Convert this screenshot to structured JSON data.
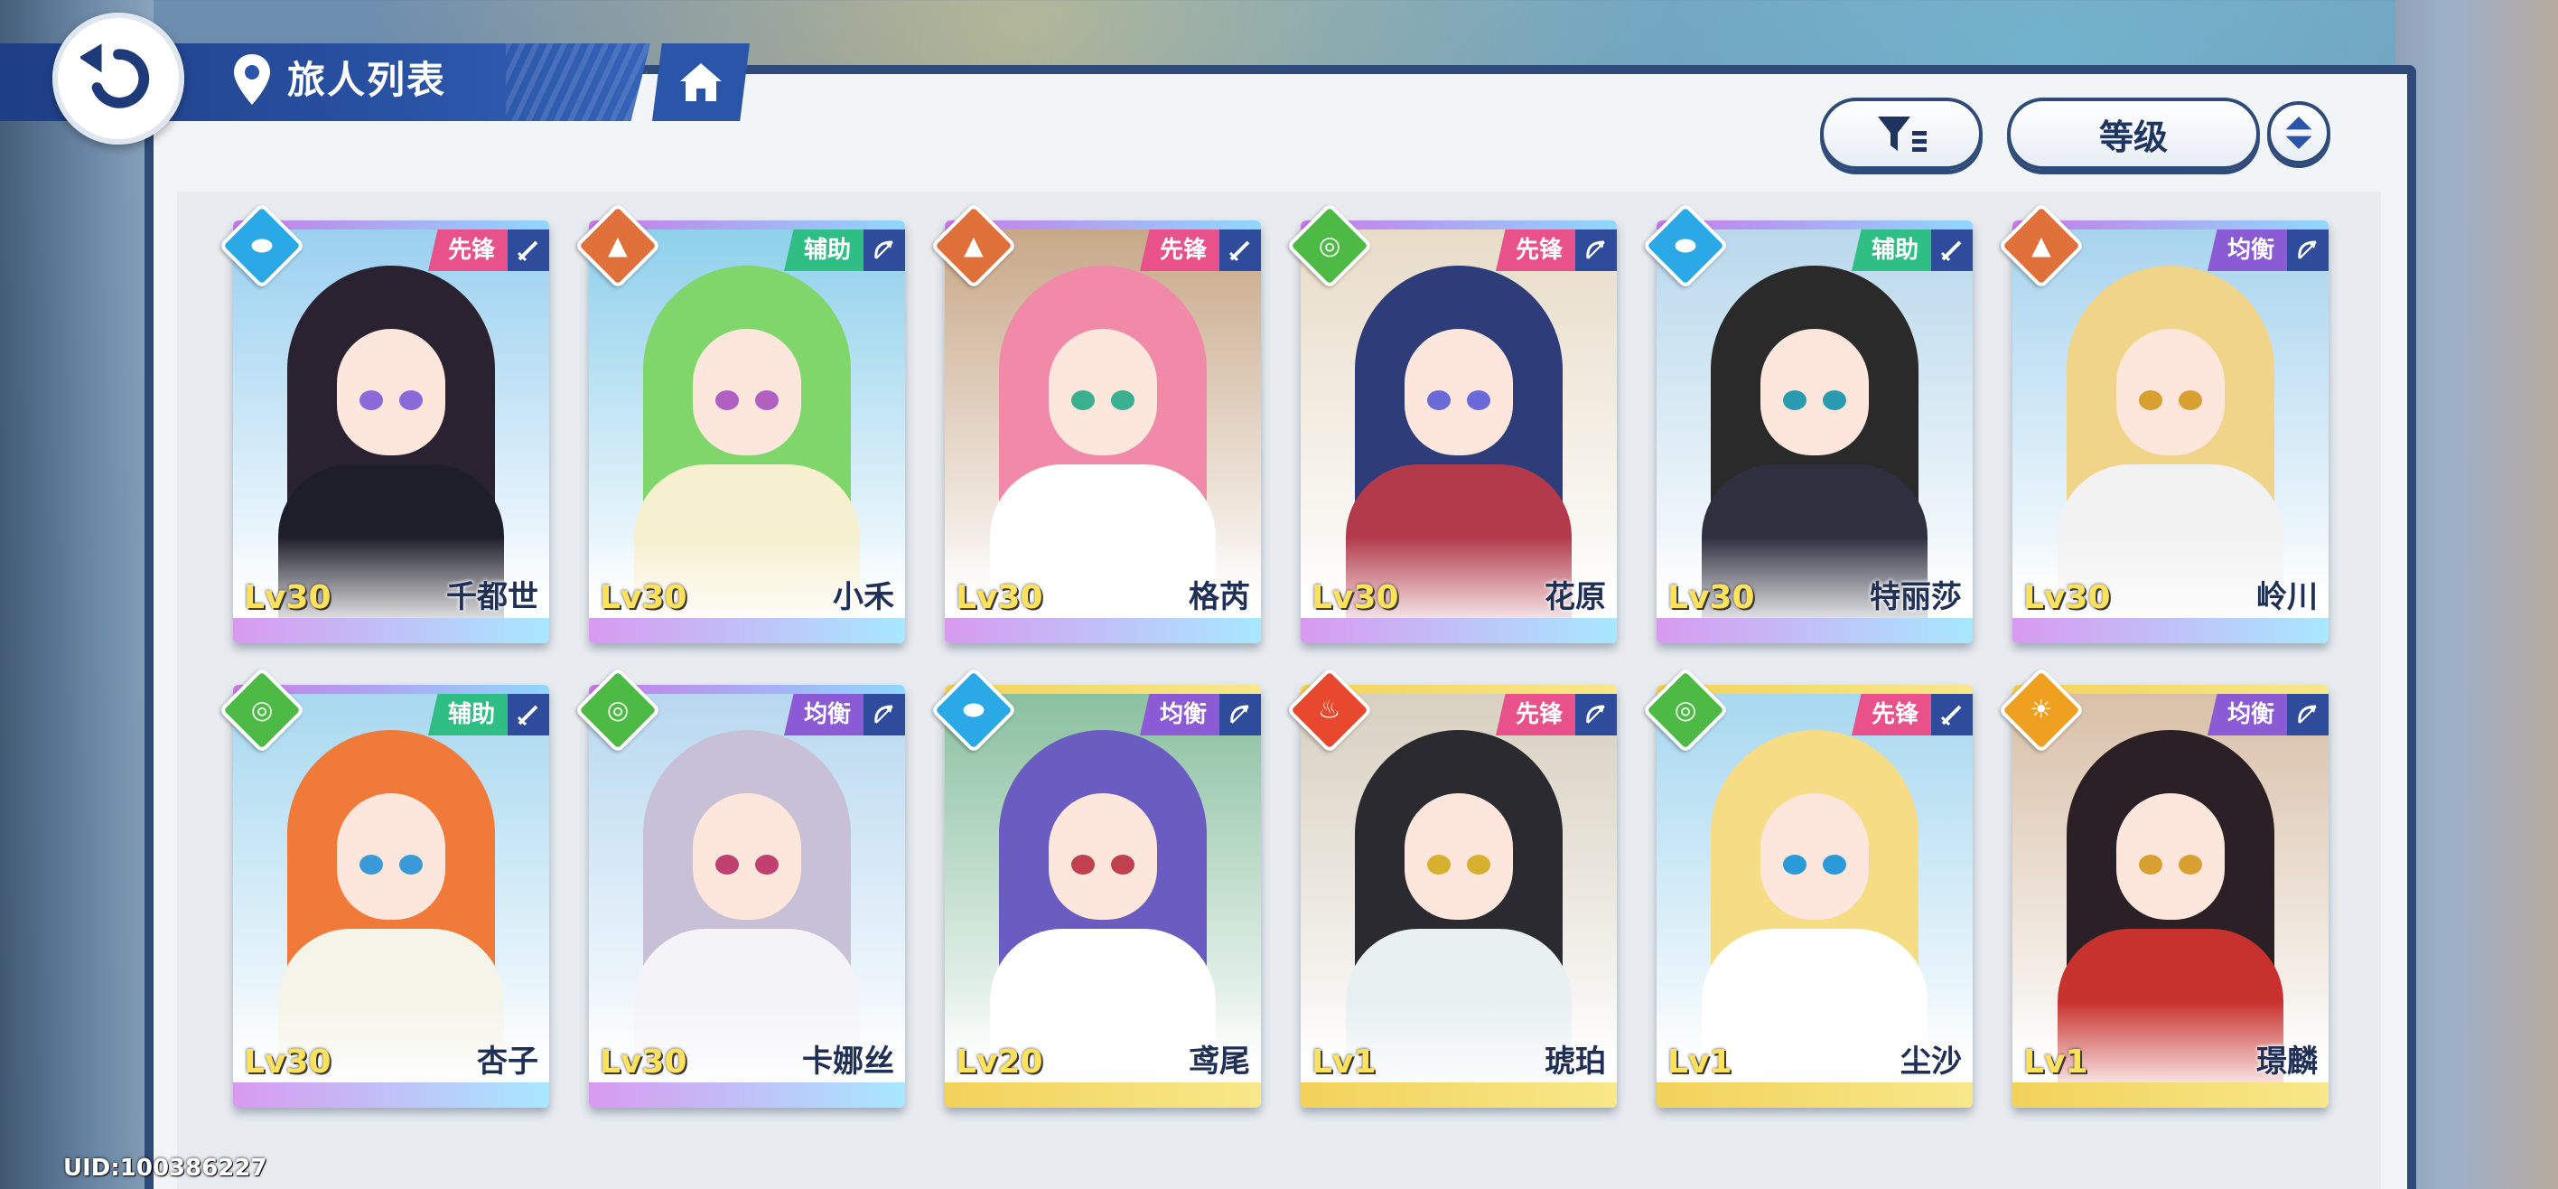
{
  "header": {
    "title": "旅人列表"
  },
  "toolbar": {
    "sort_label": "等级"
  },
  "uid": "UID:100386227",
  "colors": {
    "accent_navy": "#2e4a78",
    "water": "#2aa9e6",
    "earth": "#e0703a",
    "wind": "#4cba44",
    "fire": "#e8482e",
    "light": "#f0a020",
    "role_vanguard": "#e8518a",
    "role_support": "#2fbf84",
    "role_balance": "#8b5bd6"
  },
  "cards": [
    {
      "name": "千都世",
      "level": "Lv30",
      "role": "先锋",
      "element": "water",
      "weapon": "sword-icon"
    },
    {
      "name": "小禾",
      "level": "Lv30",
      "role": "辅助",
      "element": "earth",
      "weapon": "bow-icon"
    },
    {
      "name": "格芮",
      "level": "Lv30",
      "role": "先锋",
      "element": "earth",
      "weapon": "sword-icon"
    },
    {
      "name": "花原",
      "level": "Lv30",
      "role": "先锋",
      "element": "wind",
      "weapon": "bow-icon"
    },
    {
      "name": "特丽莎",
      "level": "Lv30",
      "role": "辅助",
      "element": "water",
      "weapon": "sword-icon"
    },
    {
      "name": "岭川",
      "level": "Lv30",
      "role": "均衡",
      "element": "earth",
      "weapon": "bow-icon"
    },
    {
      "name": "杏子",
      "level": "Lv30",
      "role": "辅助",
      "element": "wind",
      "weapon": "sword-icon"
    },
    {
      "name": "卡娜丝",
      "level": "Lv30",
      "role": "均衡",
      "element": "wind",
      "weapon": "bow-icon"
    },
    {
      "name": "鸢尾",
      "level": "Lv20",
      "role": "均衡",
      "element": "water",
      "weapon": "bow-icon"
    },
    {
      "name": "琥珀",
      "level": "Lv1",
      "role": "先锋",
      "element": "fire",
      "weapon": "bow-icon"
    },
    {
      "name": "尘沙",
      "level": "Lv1",
      "role": "先锋",
      "element": "wind",
      "weapon": "sword-icon"
    },
    {
      "name": "璟麟",
      "level": "Lv1",
      "role": "均衡",
      "element": "light",
      "weapon": "bow-icon"
    }
  ]
}
